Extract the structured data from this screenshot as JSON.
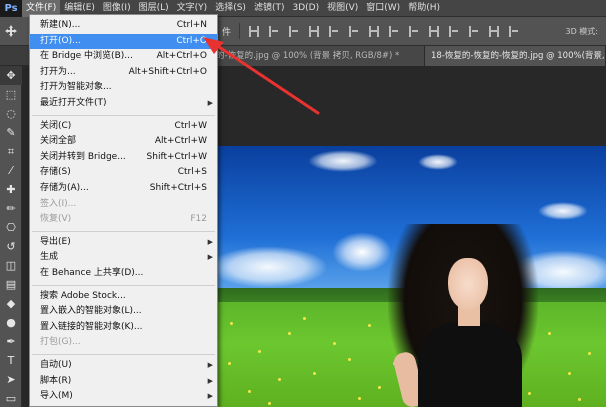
{
  "app": {
    "logo": "Ps"
  },
  "menubar": {
    "items": [
      {
        "label": "文件(F)",
        "active": true
      },
      {
        "label": "编辑(E)"
      },
      {
        "label": "图像(I)"
      },
      {
        "label": "图层(L)"
      },
      {
        "label": "文字(Y)"
      },
      {
        "label": "选择(S)"
      },
      {
        "label": "滤镜(T)"
      },
      {
        "label": "3D(D)"
      },
      {
        "label": "视图(V)"
      },
      {
        "label": "窗口(W)"
      },
      {
        "label": "帮助(H)"
      }
    ]
  },
  "options": {
    "partial_label": "件",
    "mode_label": "3D 模式:"
  },
  "tabs": [
    {
      "label": "的-恢复的.jpg @ 100% (背景 拷贝, RGB/8#) *"
    },
    {
      "label": "18-恢复的-恢复的-恢复的.jpg @ 100%(背景, RGB/8#)"
    }
  ],
  "file_menu": {
    "items": [
      {
        "label": "新建(N)...",
        "shortcut": "Ctrl+N"
      },
      {
        "label": "打开(O)...",
        "shortcut": "Ctrl+O",
        "highlighted": true
      },
      {
        "label": "在 Bridge 中浏览(B)...",
        "shortcut": "Alt+Ctrl+O"
      },
      {
        "label": "打开为...",
        "shortcut": "Alt+Shift+Ctrl+O"
      },
      {
        "label": "打开为智能对象..."
      },
      {
        "label": "最近打开文件(T)",
        "submenu": true
      },
      {
        "label": "关闭(C)",
        "shortcut": "Ctrl+W"
      },
      {
        "label": "关闭全部",
        "shortcut": "Alt+Ctrl+W"
      },
      {
        "label": "关闭并转到 Bridge...",
        "shortcut": "Shift+Ctrl+W"
      },
      {
        "label": "存储(S)",
        "shortcut": "Ctrl+S"
      },
      {
        "label": "存储为(A)...",
        "shortcut": "Shift+Ctrl+S"
      },
      {
        "label": "签入(I)...",
        "disabled": true
      },
      {
        "label": "恢复(V)",
        "shortcut": "F12",
        "disabled": true
      },
      {
        "label": "导出(E)",
        "submenu": true
      },
      {
        "label": "生成",
        "submenu": true
      },
      {
        "label": "在 Behance 上共享(D)..."
      },
      {
        "label": "搜索 Adobe Stock..."
      },
      {
        "label": "置入嵌入的智能对象(L)..."
      },
      {
        "label": "置入链接的智能对象(K)..."
      },
      {
        "label": "打包(G)...",
        "disabled": true
      },
      {
        "label": "自动(U)",
        "submenu": true
      },
      {
        "label": "脚本(R)",
        "submenu": true
      },
      {
        "label": "导入(M)",
        "submenu": true
      }
    ]
  },
  "tools": [
    "move-tool-icon",
    "marquee-tool-icon",
    "lasso-tool-icon",
    "quick-select-tool-icon",
    "crop-tool-icon",
    "eyedropper-tool-icon",
    "healing-brush-tool-icon",
    "brush-tool-icon",
    "clone-stamp-tool-icon",
    "history-brush-tool-icon",
    "eraser-tool-icon",
    "gradient-tool-icon",
    "blur-tool-icon",
    "dodge-tool-icon",
    "pen-tool-icon",
    "type-tool-icon",
    "path-select-tool-icon",
    "shape-tool-icon"
  ],
  "colors": {
    "highlight": "#3f8ef0",
    "annotation_arrow": "#e8322f"
  }
}
